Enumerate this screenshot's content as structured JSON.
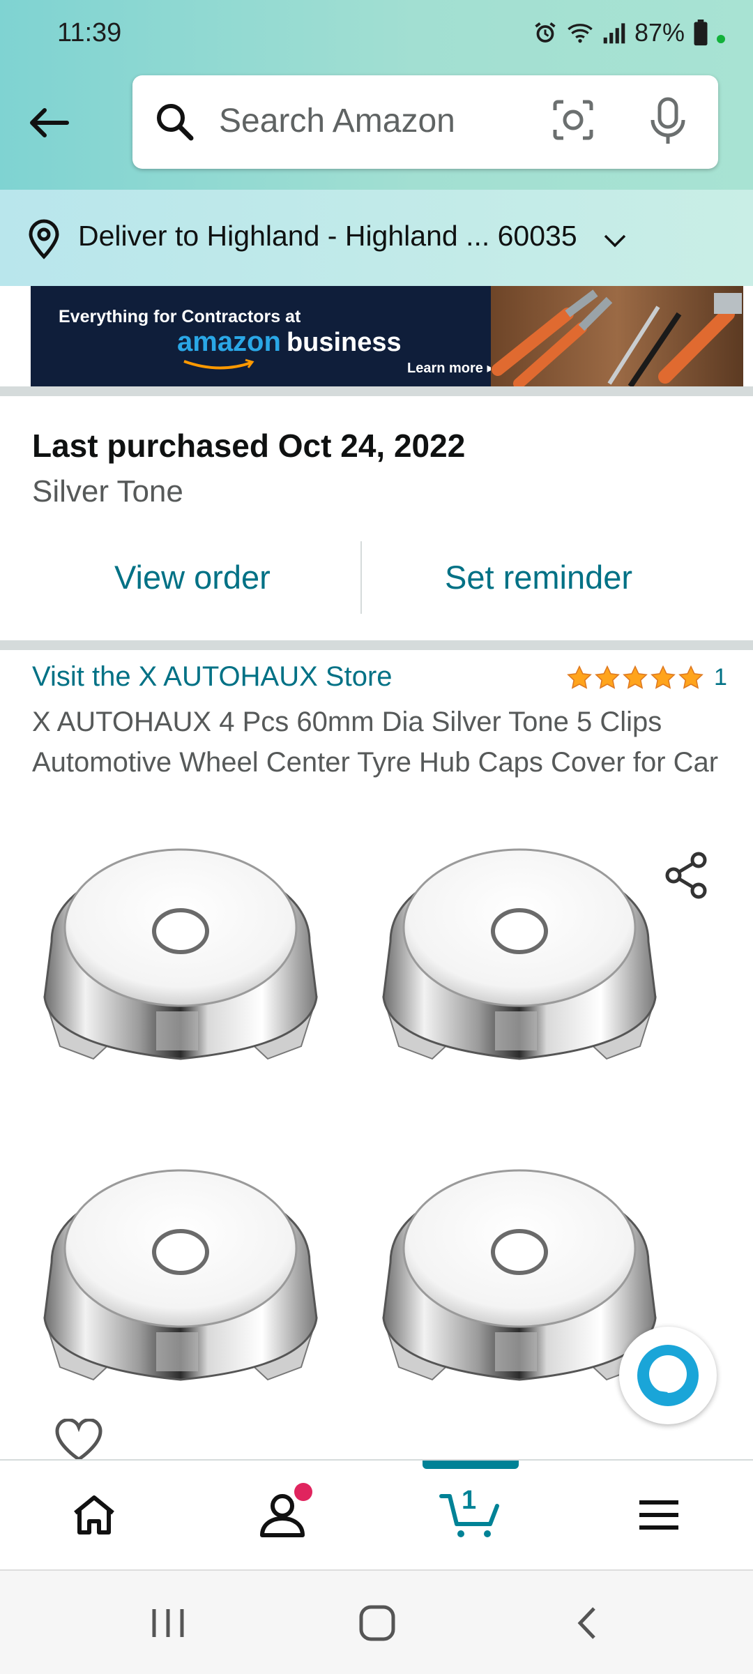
{
  "status_bar": {
    "time": "11:39",
    "battery": "87%"
  },
  "search": {
    "placeholder": "Search Amazon"
  },
  "delivery": {
    "text": "Deliver to Highland - Highland ... 60035"
  },
  "banner": {
    "line1": "Everything for Contractors at",
    "brand_amazon": "amazon",
    "brand_business": "business",
    "cta": "Learn more ▸"
  },
  "last_purchase": {
    "title": "Last purchased Oct 24, 2022",
    "variant": "Silver Tone",
    "view_order_label": "View order",
    "set_reminder_label": "Set reminder"
  },
  "product": {
    "store_link": "Visit the X AUTOHAUX Store",
    "rating_stars": 5,
    "rating_count": "1",
    "title": "X AUTOHAUX 4 Pcs 60mm Dia Silver Tone 5 Clips Automotive Wheel Center Tyre Hub Caps Cover for Car"
  },
  "bottom_nav": {
    "items": [
      "home-icon",
      "account-icon",
      "cart-icon",
      "menu-icon"
    ],
    "cart_count": "1",
    "active": "cart"
  },
  "colors": {
    "link": "#007185",
    "accent_teal": "#008296",
    "star": "#FFA41C",
    "notification": "#e0245e"
  }
}
